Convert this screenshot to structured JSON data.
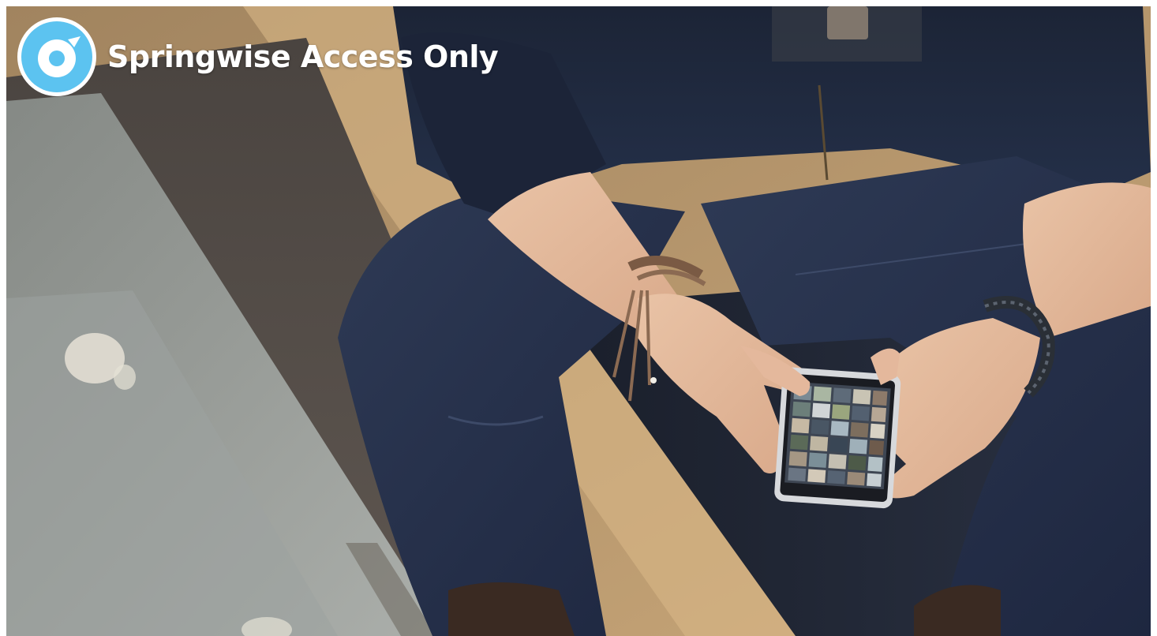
{
  "banner": {
    "title": "Springwise Access Only",
    "logo_icon": "springwise-logo-icon",
    "logo_color": "#5cc3f0",
    "logo_ring_color": "#ffffff"
  },
  "photo": {
    "subject_icon": "person-holding-smartphone-photo"
  }
}
